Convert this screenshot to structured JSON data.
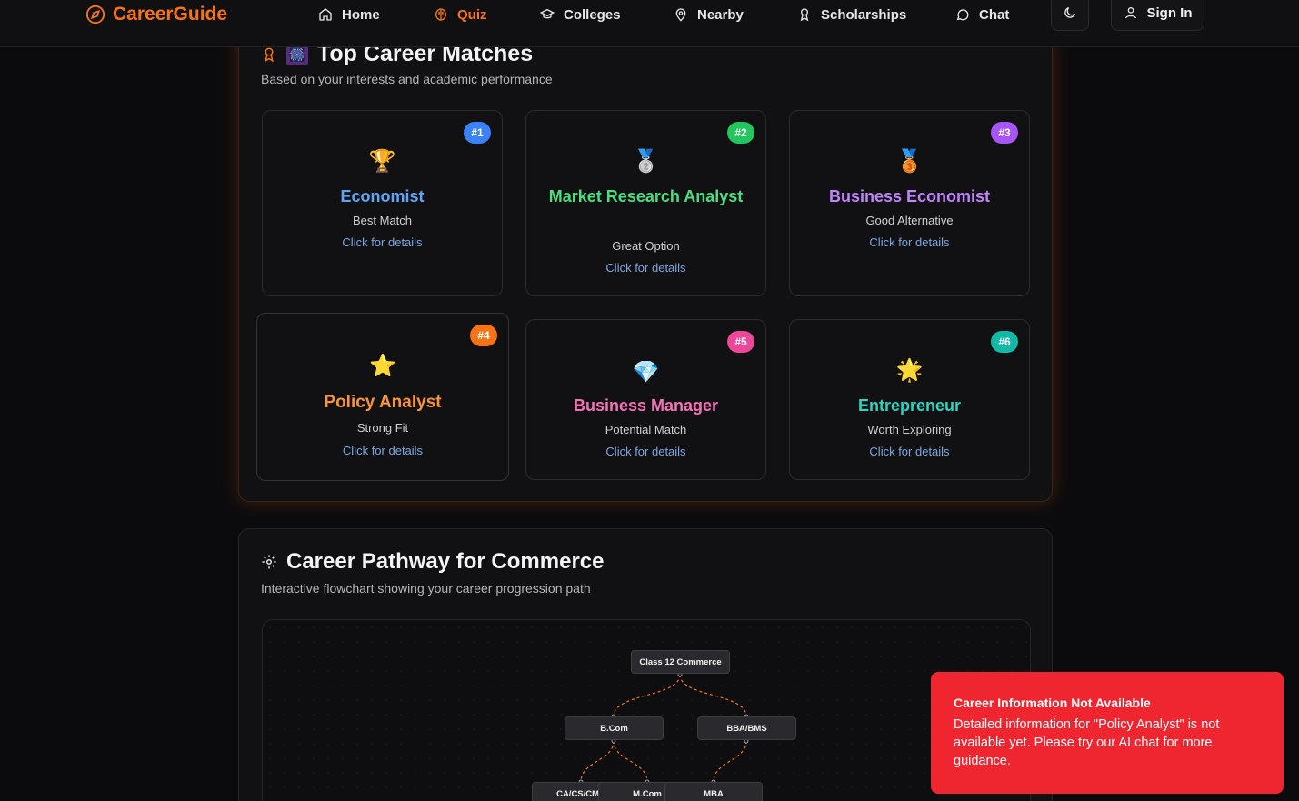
{
  "nav": {
    "brand": "CareerGuide",
    "items": [
      {
        "label": "Home",
        "icon": "home-icon",
        "active": false
      },
      {
        "label": "Quiz",
        "icon": "brain-icon",
        "active": true
      },
      {
        "label": "Colleges",
        "icon": "graduation-cap-icon",
        "active": false
      },
      {
        "label": "Nearby",
        "icon": "map-pin-icon",
        "active": false
      },
      {
        "label": "Scholarships",
        "icon": "award-icon",
        "active": false
      },
      {
        "label": "Chat",
        "icon": "message-icon",
        "active": false
      }
    ],
    "theme_toggle_icon": "moon-icon",
    "signin_label": "Sign In"
  },
  "matches": {
    "title": "Top Career Matches",
    "subtitle": "Based on your interests and academic performance",
    "cards": [
      {
        "rank": "#1",
        "emoji": "🏆",
        "title": "Economist",
        "tag": "Best Match",
        "link": "Click for details",
        "color": "#60a5fa",
        "badge": "#3b82f6"
      },
      {
        "rank": "#2",
        "emoji": "🥈",
        "title": "Market Research Analyst",
        "tag": "Great Option",
        "link": "Click for details",
        "color": "#4ade80",
        "badge": "#22c55e"
      },
      {
        "rank": "#3",
        "emoji": "🥉",
        "title": "Business Economist",
        "tag": "Good Alternative",
        "link": "Click for details",
        "color": "#c084fc",
        "badge": "#a855f7"
      },
      {
        "rank": "#4",
        "emoji": "⭐",
        "title": "Policy Analyst",
        "tag": "Strong Fit",
        "link": "Click for details",
        "color": "#fb923c",
        "badge": "#f97316"
      },
      {
        "rank": "#5",
        "emoji": "💎",
        "title": "Business Manager",
        "tag": "Potential Match",
        "link": "Click for details",
        "color": "#f472b6",
        "badge": "#ec4899"
      },
      {
        "rank": "#6",
        "emoji": "🌟",
        "title": "Entrepreneur",
        "tag": "Worth Exploring",
        "link": "Click for details",
        "color": "#2dd4bf",
        "badge": "#14b8a6"
      }
    ]
  },
  "pathway": {
    "title": "Career Pathway for Commerce",
    "subtitle": "Interactive flowchart showing your career progression path",
    "nodes": {
      "root": "Class 12 Commerce",
      "bcom": "B.Com",
      "bba": "BBA/BMS",
      "ca": "CA/CS/CMA",
      "mcom": "M.Com",
      "mba": "MBA"
    }
  },
  "toast": {
    "title": "Career Information Not Available",
    "message": "Detailed information for \"Policy Analyst\" is not available yet. Please try our AI chat for more guidance."
  }
}
